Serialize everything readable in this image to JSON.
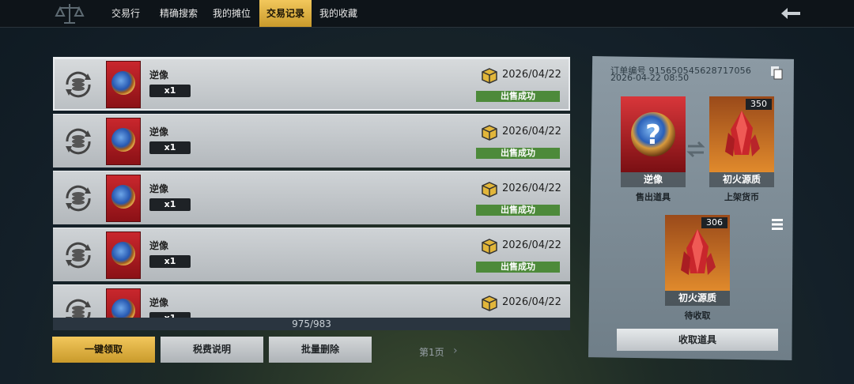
{
  "tabs": [
    {
      "label": "交易行",
      "active": false
    },
    {
      "label": "精确搜索",
      "active": false
    },
    {
      "label": "我的摊位",
      "active": false
    },
    {
      "label": "交易记录",
      "active": true
    },
    {
      "label": "我的收藏",
      "active": false
    }
  ],
  "records": [
    {
      "item": "逆像",
      "qty": "x1",
      "date": "2026/04/22",
      "status": "出售成功",
      "selected": true
    },
    {
      "item": "逆像",
      "qty": "x1",
      "date": "2026/04/22",
      "status": "出售成功",
      "selected": false
    },
    {
      "item": "逆像",
      "qty": "x1",
      "date": "2026/04/22",
      "status": "出售成功",
      "selected": false
    },
    {
      "item": "逆像",
      "qty": "x1",
      "date": "2026/04/22",
      "status": "出售成功",
      "selected": false
    },
    {
      "item": "逆像",
      "qty": "x1",
      "date": "2026/04/22",
      "status": "出售成功",
      "selected": false
    }
  ],
  "pager": {
    "count": "975/983",
    "page": "第1页"
  },
  "buttons": {
    "claim_all": "一键领取",
    "tax_info": "税费说明",
    "batch_delete": "批量删除"
  },
  "detail": {
    "order_no": "订单编号 915650545628717056",
    "order_time": "2026-04-22 08:50",
    "sold_item": {
      "name": "逆像",
      "label": "售出道具"
    },
    "listed_currency": {
      "name": "初火源质",
      "count": "350",
      "label": "上架货币"
    },
    "pending": {
      "name": "初火源质",
      "count": "306",
      "label": "待收取"
    },
    "collect_button": "收取道具"
  },
  "colors": {
    "accent": "#e5b449",
    "success": "#4d8a3a",
    "item_red": "#c9272d",
    "crystal_orange": "#c8651f"
  },
  "icons": [
    "logo-icon",
    "back-arrow-icon",
    "coin-cycle-icon",
    "box-icon",
    "copy-icon",
    "swap-arrows-icon",
    "menu-icon",
    "chevron-right-icon"
  ]
}
